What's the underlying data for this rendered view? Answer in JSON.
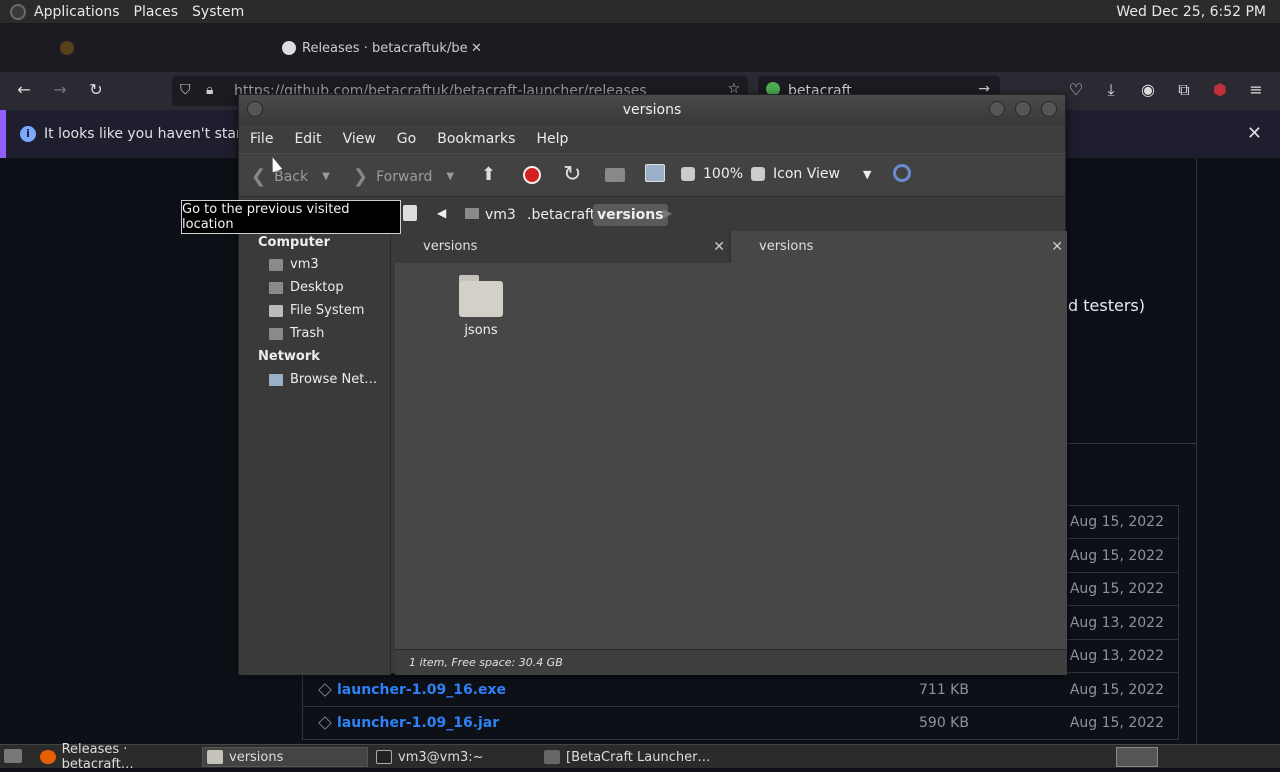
{
  "top_panel": {
    "menus": [
      "Applications",
      "Places",
      "System"
    ],
    "clock": "Wed Dec 25,  6:52 PM"
  },
  "firefox": {
    "tab_active_title": "Releases · betacraftuk/beta",
    "url": "https://github.com/betacraftuk/betacraft-launcher/releases",
    "search_text": "betacraft",
    "notification": "It looks like you haven't started Fi"
  },
  "github": {
    "side_text": "d testers)",
    "rows": [
      {
        "asset": "",
        "size": "",
        "date": "Aug 15, 2022"
      },
      {
        "asset": "",
        "size": "",
        "date": "Aug 15, 2022"
      },
      {
        "asset": "",
        "size": "",
        "date": "Aug 15, 2022"
      },
      {
        "asset": "",
        "size": "",
        "date": "Aug 13, 2022"
      },
      {
        "asset": "",
        "size": "",
        "date": "Aug 13, 2022"
      },
      {
        "asset": "launcher-1.09_16.exe",
        "size": "711 KB",
        "date": "Aug 15, 2022"
      },
      {
        "asset": "launcher-1.09_16.jar",
        "size": "590 KB",
        "date": "Aug 15, 2022"
      }
    ]
  },
  "file_manager": {
    "title": "versions",
    "menu": [
      "File",
      "Edit",
      "View",
      "Go",
      "Bookmarks",
      "Help"
    ],
    "toolbar": {
      "back": "Back",
      "forward": "Forward",
      "zoom": "100%",
      "view_mode": "Icon View"
    },
    "breadcrumbs": [
      "vm3",
      ".betacraft",
      "versions"
    ],
    "sidebar": {
      "computer_header": "Computer",
      "computer_items": [
        "vm3",
        "Desktop",
        "File System",
        "Trash"
      ],
      "network_header": "Network",
      "network_items": [
        "Browse Net…"
      ]
    },
    "tabs": [
      "versions",
      "versions"
    ],
    "items": [
      {
        "name": "jsons"
      }
    ],
    "status": "1 item, Free space: 30.4 GB",
    "tooltip": "Go to the previous visited location"
  },
  "taskbar": {
    "items": [
      "Releases · betacraft…",
      "versions",
      "vm3@vm3:~",
      "[BetaCraft Launcher…"
    ]
  }
}
